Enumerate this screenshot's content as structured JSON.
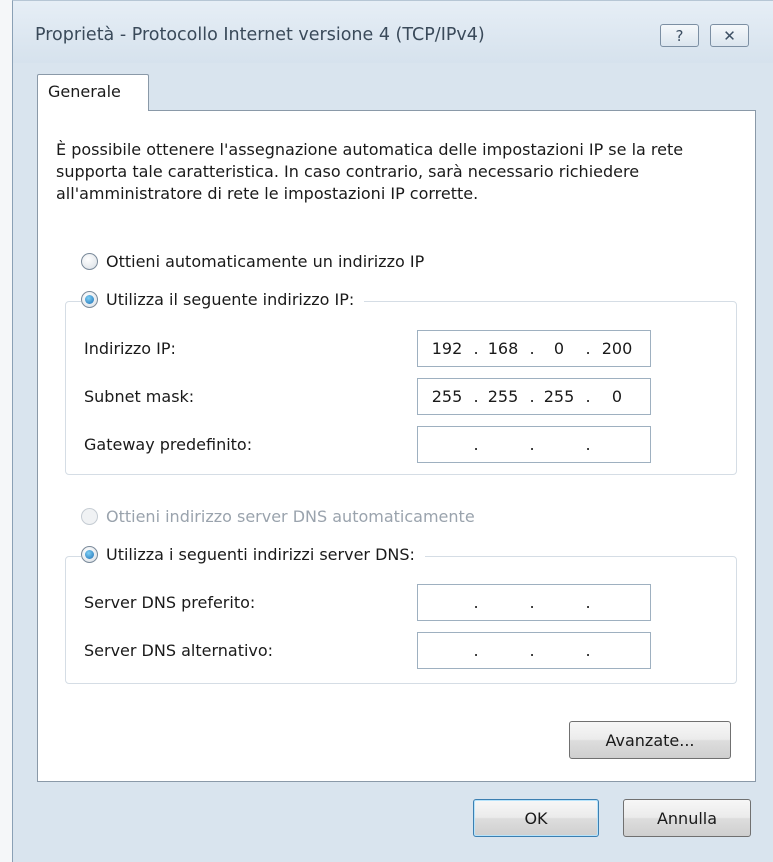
{
  "window": {
    "title": "Proprietà - Protocollo Internet versione 4 (TCP/IPv4)",
    "help_icon": "?",
    "close_icon": "✕"
  },
  "tabs": [
    {
      "label": "Generale",
      "selected": true
    }
  ],
  "general": {
    "intro": "È possibile ottenere l'assegnazione automatica delle impostazioni IP se la rete supporta tale caratteristica. In caso contrario, sarà necessario richiedere all'amministratore di rete le impostazioni IP corrette.",
    "ip_auto": {
      "label": "Ottieni automaticamente un indirizzo IP",
      "checked": false
    },
    "ip_manual": {
      "label": "Utilizza il seguente indirizzo IP:",
      "checked": true
    },
    "ip_fields": [
      {
        "label": "Indirizzo IP:",
        "octets": [
          "192",
          "168",
          "0",
          "200"
        ]
      },
      {
        "label": "Subnet mask:",
        "octets": [
          "255",
          "255",
          "255",
          "0"
        ]
      },
      {
        "label": "Gateway predefinito:",
        "octets": [
          "",
          "",
          "",
          ""
        ]
      }
    ],
    "dns_auto": {
      "label": "Ottieni indirizzo server DNS automaticamente",
      "checked": false,
      "disabled": true
    },
    "dns_manual": {
      "label": "Utilizza i seguenti indirizzi server DNS:",
      "checked": true
    },
    "dns_fields": [
      {
        "label": "Server DNS preferito:",
        "octets": [
          "",
          "",
          "",
          ""
        ]
      },
      {
        "label": "Server DNS alternativo:",
        "octets": [
          "",
          "",
          "",
          ""
        ]
      }
    ],
    "advanced_label": "Avanzate..."
  },
  "footer": {
    "ok_label": "OK",
    "cancel_label": "Annulla"
  },
  "colors": {
    "window_frame": "#d9e4ee",
    "radio_selected": "#1d6fb5"
  }
}
